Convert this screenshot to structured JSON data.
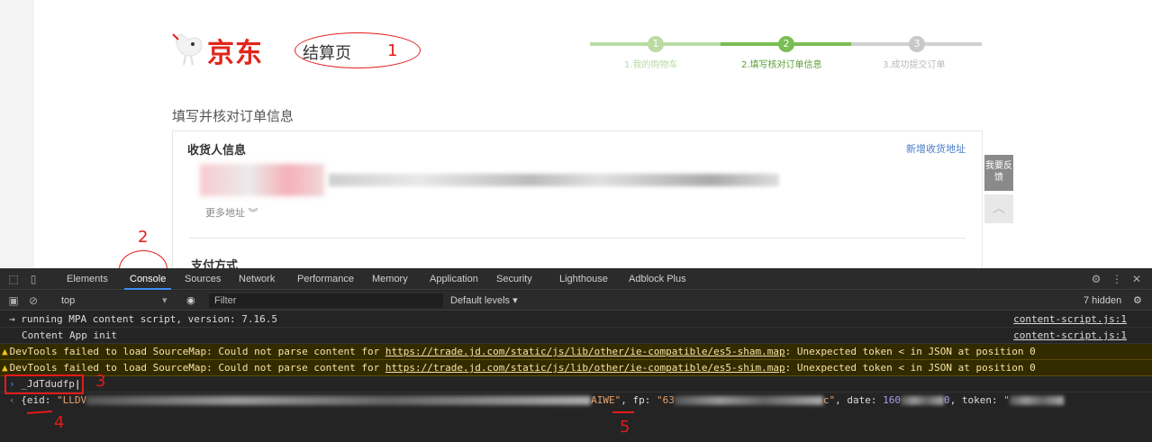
{
  "site": {
    "logo_text": "京东",
    "page_title": "结算页",
    "steps": [
      {
        "num": "1",
        "label": "1.我的购物车",
        "state": "done"
      },
      {
        "num": "2",
        "label": "2.填写核对订单信息",
        "state": "current"
      },
      {
        "num": "3",
        "label": "3.成功提交订单",
        "state": "todo"
      }
    ],
    "section_title": "填写并核对订单信息",
    "consignee_title": "收货人信息",
    "add_address": "新增收货地址",
    "more_address": "更多地址 ︾",
    "payment_title": "支付方式",
    "feedback": "我要反馈",
    "back_top": "︿"
  },
  "annotations": {
    "n1": "1",
    "n2": "2",
    "n3": "3",
    "n4": "4",
    "n5": "5"
  },
  "devtools": {
    "tabs": [
      "Elements",
      "Console",
      "Sources",
      "Network",
      "Performance",
      "Memory",
      "Application",
      "Security",
      "Lighthouse",
      "Adblock Plus"
    ],
    "active_tab": "Console",
    "context": "top",
    "filter_placeholder": "Filter",
    "levels": "Default levels ▾",
    "hidden_count": "7 hidden",
    "logs": [
      {
        "type": "info",
        "text": "→ running MPA content script, version: 7.16.5",
        "source": "content-script.js:1"
      },
      {
        "type": "info",
        "text": "Content App init",
        "source": "content-script.js:1"
      },
      {
        "type": "warn",
        "prefix": "DevTools failed to load SourceMap: Could not parse content for ",
        "url": "https://trade.jd.com/static/js/lib/other/ie-compatible/es5-sham.map",
        "suffix": ": Unexpected token < in JSON at position 0"
      },
      {
        "type": "warn",
        "prefix": "DevTools failed to load SourceMap: Could not parse content for ",
        "url": "https://trade.jd.com/static/js/lib/other/ie-compatible/es5-shim.map",
        "suffix": ": Unexpected token < in JSON at position 0"
      }
    ],
    "input_command": "_JdTdudfp",
    "result": {
      "eid_key": "{eid: ",
      "eid_start": "\"LLDV",
      "eid_end": "AIWE\"",
      "fp_key": ", fp: ",
      "fp_start": "\"63",
      "fp_end": "c\"",
      "date_key": ", date: ",
      "date_start": "160",
      "date_end": "0",
      "token_key": ", token: ",
      "token_start": "\""
    }
  },
  "colors": {
    "jd_red": "#e1251b",
    "step_green": "#7abd54",
    "annotation_red": "#e41a1a",
    "devtools_bg": "#242424",
    "warn_bg": "#332b00"
  }
}
